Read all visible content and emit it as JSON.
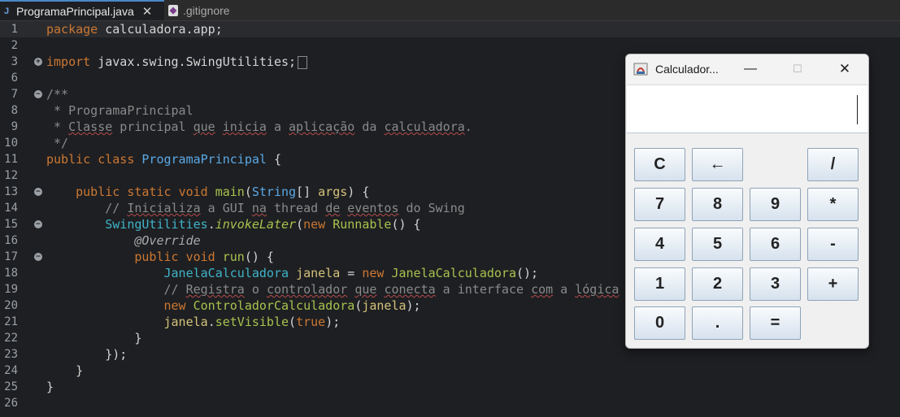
{
  "tabs": [
    {
      "label": "ProgramaPrincipal.java",
      "icon": "java-file-icon",
      "active": true
    },
    {
      "label": ".gitignore",
      "icon": "git-file-icon",
      "active": false
    }
  ],
  "editor": {
    "line_numbers": [
      "1",
      "2",
      "3",
      "6",
      "7",
      "8",
      "9",
      "10",
      "11",
      "12",
      "13",
      "14",
      "15",
      "16",
      "17",
      "18",
      "19",
      "20",
      "21",
      "22",
      "23",
      "24",
      "25",
      "26"
    ],
    "lines": {
      "l1": {
        "kw": "package",
        "rest": " calculadora.app;"
      },
      "l3": {
        "kw": "import",
        "rest": " javax.swing.SwingUtilities;"
      },
      "l7": "/**",
      "l8": " * ProgramaPrincipal",
      "l9": {
        "pre": " * ",
        "w1": "Classe",
        "t1": " principal ",
        "w2": "que",
        "t2": " ",
        "w3": "inicia",
        "t3": " a ",
        "w4": "aplicação",
        "t4": " da ",
        "w5": "calculadora",
        "t5": "."
      },
      "l10": " */",
      "l11": {
        "kw1": "public",
        "kw2": "class",
        "name": "ProgramaPrincipal",
        "rest": " {"
      },
      "l13": {
        "kw1": "public",
        "kw2": "static",
        "kw3": "void",
        "meth": "main",
        "typ": "String",
        "br": "[] ",
        "var": "args",
        "rest": ") {"
      },
      "l14": {
        "pre": "// ",
        "w1": "Inicializa",
        "t1": " a GUI ",
        "w2": "na",
        "t2": " thread ",
        "w3": "de",
        "t3": " ",
        "w4": "eventos",
        "t4": " do Swing"
      },
      "l15": {
        "cls": "SwingUtilities",
        "dot": ".",
        "meth": "invokeLater",
        "open": "(",
        "kw": "new",
        "sp": " ",
        "typ": "Runnable",
        "rest": "() {"
      },
      "l16": "@Override",
      "l17": {
        "kw1": "public",
        "kw2": "void",
        "meth": "run",
        "rest": "() {"
      },
      "l18": {
        "cls": "JanelaCalculadora",
        "sp": " ",
        "var": "janela",
        "eq": " = ",
        "kw": "new",
        "sp2": " ",
        "cls2": "JanelaCalculadora",
        "rest": "();"
      },
      "l19": {
        "pre": "// ",
        "w1": "Registra",
        "t1": " o ",
        "w2": "controlador",
        "t2": " ",
        "w3": "que",
        "t3": " ",
        "w4": "conecta",
        "t4": " a interface ",
        "w5": "com",
        "t5": " a ",
        "w6": "lógica"
      },
      "l20": {
        "kw": "new",
        "sp": " ",
        "cls": "ControladorCalculadora",
        "open": "(",
        "var": "janela",
        "rest": ");"
      },
      "l21": {
        "var": "janela",
        "dot": ".",
        "meth": "setVisible",
        "open": "(",
        "kw": "true",
        "rest": ");"
      },
      "l22": "}",
      "l23": "});",
      "l24": "}",
      "l25": "}"
    }
  },
  "calculator": {
    "title": "Calculador...",
    "display_value": "",
    "keys": [
      "C",
      "←",
      "/",
      "7",
      "8",
      "9",
      "*",
      "4",
      "5",
      "6",
      "-",
      "1",
      "2",
      "3",
      "+",
      "0",
      ".",
      "="
    ]
  }
}
